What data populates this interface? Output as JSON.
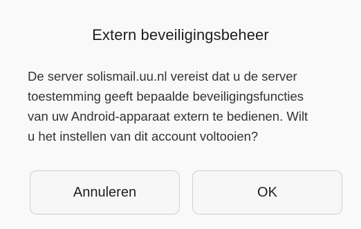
{
  "dialog": {
    "title": "Extern beveiligingsbeheer",
    "message_lines": [
      "De server solismail.uu.nl vereist dat u de server",
      "toestemming geeft bepaalde beveiligingsfuncties",
      "van uw Android-apparaat extern te bedienen. Wilt",
      "u het instellen van dit account voltooien?"
    ],
    "buttons": {
      "cancel_label": "Annuleren",
      "ok_label": "OK"
    }
  }
}
